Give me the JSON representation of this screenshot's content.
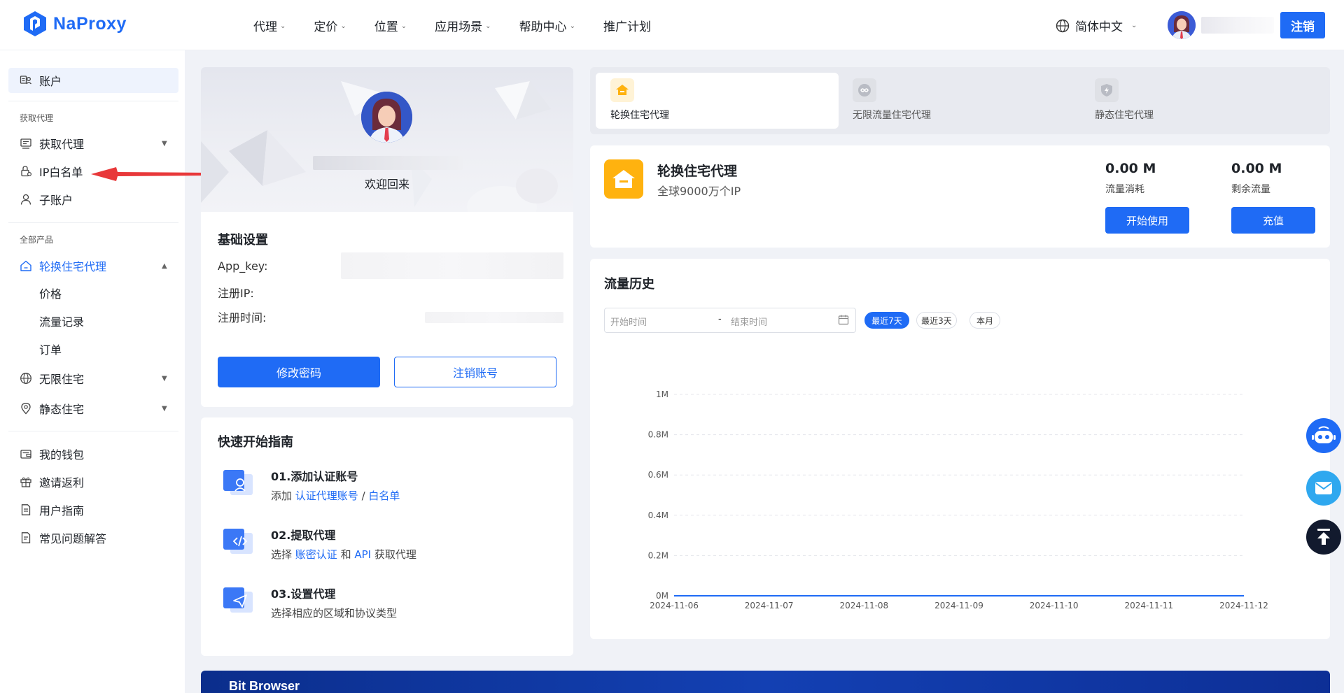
{
  "brand": {
    "name": "NaProxy",
    "color": "#1f6bf5"
  },
  "nav": {
    "items": [
      {
        "label": "代理",
        "has_menu": true
      },
      {
        "label": "定价",
        "has_menu": true
      },
      {
        "label": "位置",
        "has_menu": true
      },
      {
        "label": "应用场景",
        "has_menu": true
      },
      {
        "label": "帮助中心",
        "has_menu": true
      },
      {
        "label": "推广计划",
        "has_menu": false
      }
    ],
    "language": "简体中文",
    "logout": "注销"
  },
  "sidebar": {
    "account": "账户",
    "section_get_proxy": "获取代理",
    "get_proxy": "获取代理",
    "ip_whitelist": "IP白名单",
    "sub_account": "子账户",
    "section_all_products": "全部产品",
    "rotating_residential": "轮换住宅代理",
    "price": "价格",
    "traffic_records": "流量记录",
    "orders": "订单",
    "unlimited_residential": "无限住宅",
    "static_residential": "静态住宅",
    "wallet": "我的钱包",
    "referral": "邀请返利",
    "user_guide": "用户指南",
    "faq": "常见问题解答"
  },
  "profile": {
    "welcome": "欢迎回来",
    "basic_settings": "基础设置",
    "app_key_label": "App_key:",
    "reg_ip_label": "注册IP:",
    "reg_time_label": "注册时间:",
    "change_password": "修改密码",
    "delete_account": "注销账号"
  },
  "quick_start": {
    "title": "快速开始指南",
    "steps": [
      {
        "title": "01.添加认证账号",
        "prefix": "添加 ",
        "link1": "认证代理账号",
        "mid": " / ",
        "link2": "白名单",
        "suffix": ""
      },
      {
        "title": "02.提取代理",
        "prefix": "选择 ",
        "link1": "账密认证",
        "mid": " 和 ",
        "link2": "API",
        "suffix": " 获取代理"
      },
      {
        "title": "03.设置代理",
        "desc": "选择相应的区域和协议类型"
      }
    ]
  },
  "product_tabs": [
    {
      "label": "轮换住宅代理",
      "active": true
    },
    {
      "label": "无限流量住宅代理",
      "active": false
    },
    {
      "label": "静态住宅代理",
      "active": false
    }
  ],
  "product": {
    "title": "轮换住宅代理",
    "subtitle": "全球9000万个IP",
    "used_value": "0.00 M",
    "used_label": "流量消耗",
    "remaining_value": "0.00 M",
    "remaining_label": "剩余流量",
    "start_button": "开始使用",
    "recharge_button": "充值"
  },
  "traffic": {
    "title": "流量历史",
    "start_placeholder": "开始时间",
    "separator": "-",
    "end_placeholder": "结束时间",
    "filters": [
      {
        "label": "最近7天",
        "active": true
      },
      {
        "label": "最近3天",
        "active": false
      },
      {
        "label": "本月",
        "active": false
      }
    ]
  },
  "chart_data": {
    "type": "line",
    "x": [
      "2024-11-06",
      "2024-11-07",
      "2024-11-08",
      "2024-11-09",
      "2024-11-10",
      "2024-11-11",
      "2024-11-12"
    ],
    "series": [
      {
        "values": [
          0,
          0,
          0,
          0,
          0,
          0,
          0
        ],
        "color": "#1f6bf5"
      }
    ],
    "y_ticks": [
      "0M",
      "0.2M",
      "0.4M",
      "0.6M",
      "0.8M",
      "1M"
    ],
    "ylim": [
      0,
      1
    ],
    "grid": true
  },
  "banner": {
    "text": "Bit Browser"
  }
}
